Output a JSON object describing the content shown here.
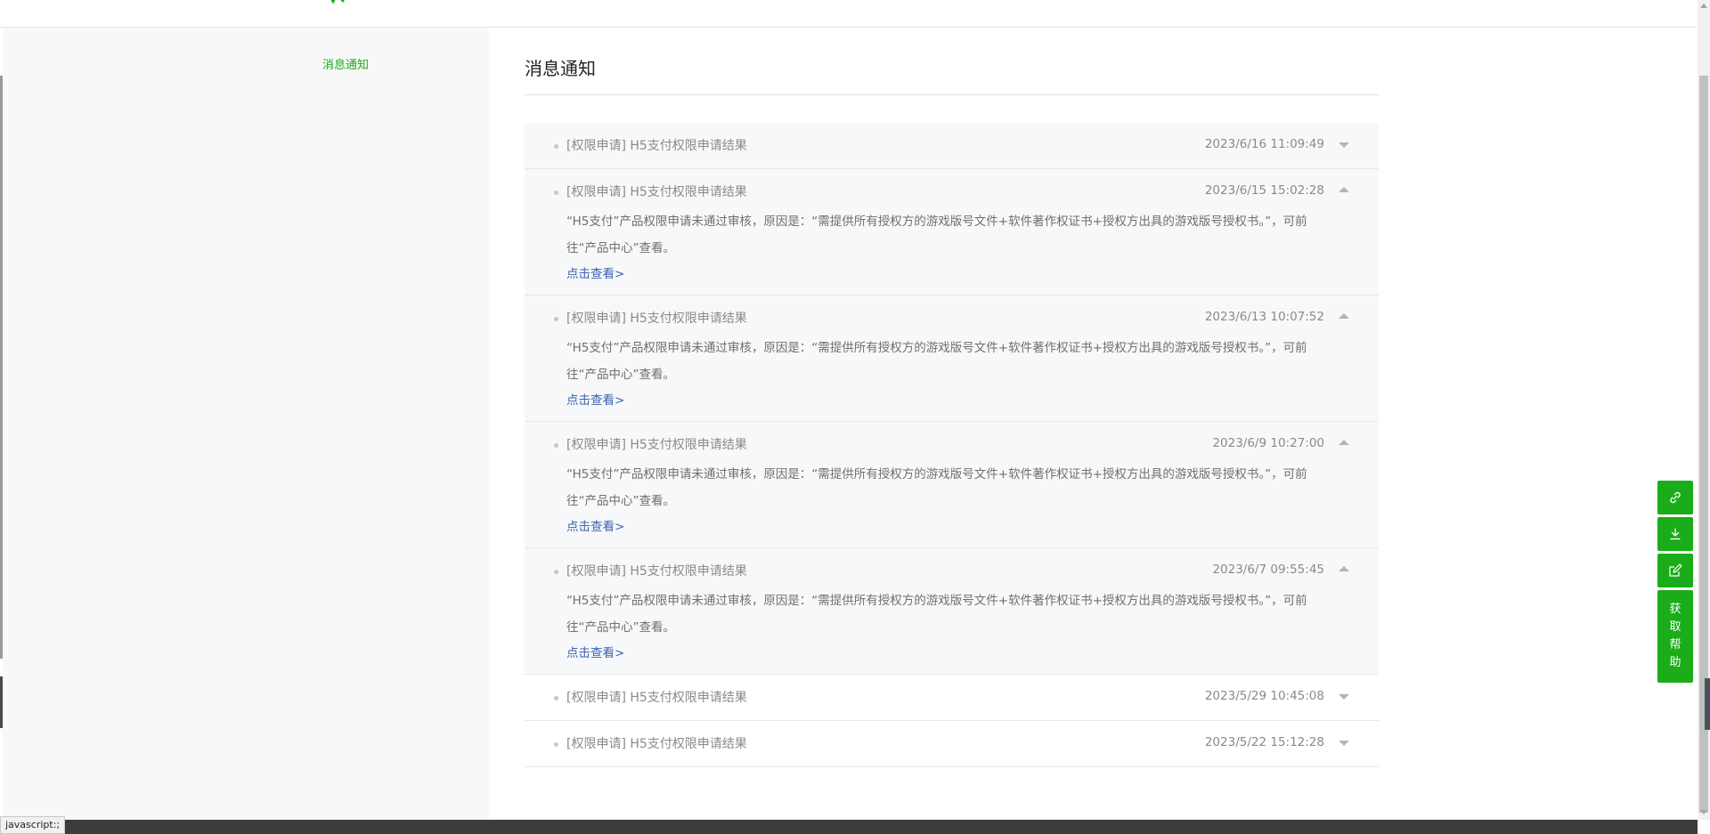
{
  "sidebar": {
    "items": [
      {
        "label": "消息通知"
      }
    ]
  },
  "main": {
    "title": "消息通知",
    "notifications": [
      {
        "title": "[权限申请] H5支付权限申请结果",
        "time": "2023/6/16 11:09:49",
        "expanded": false
      },
      {
        "title": "[权限申请] H5支付权限申请结果",
        "time": "2023/6/15 15:02:28",
        "expanded": true,
        "body": "“H5支付”产品权限申请未通过审核，原因是：“需提供所有授权方的游戏版号文件+软件著作权证书+授权方出具的游戏版号授权书。”，可前往“产品中心”查看。",
        "link": "点击查看>"
      },
      {
        "title": "[权限申请] H5支付权限申请结果",
        "time": "2023/6/13 10:07:52",
        "expanded": true,
        "body": "“H5支付”产品权限申请未通过审核，原因是：“需提供所有授权方的游戏版号文件+软件著作权证书+授权方出具的游戏版号授权书。”，可前往“产品中心”查看。",
        "link": "点击查看>"
      },
      {
        "title": "[权限申请] H5支付权限申请结果",
        "time": "2023/6/9 10:27:00",
        "expanded": true,
        "body": "“H5支付”产品权限申请未通过审核，原因是：“需提供所有授权方的游戏版号文件+软件著作权证书+授权方出具的游戏版号授权书。”，可前往“产品中心”查看。",
        "link": "点击查看>"
      },
      {
        "title": "[权限申请] H5支付权限申请结果",
        "time": "2023/6/7 09:55:45",
        "expanded": true,
        "body": "“H5支付”产品权限申请未通过审核，原因是：“需提供所有授权方的游戏版号文件+软件著作权证书+授权方出具的游戏版号授权书。”，可前往“产品中心”查看。",
        "link": "点击查看>"
      },
      {
        "title": "[权限申请] H5支付权限申请结果",
        "time": "2023/5/29 10:45:08",
        "expanded": false
      },
      {
        "title": "[权限申请] H5支付权限申请结果",
        "time": "2023/5/22 15:12:28",
        "expanded": false
      }
    ]
  },
  "float_tools": {
    "icons": [
      "link-icon",
      "download-icon",
      "edit-icon"
    ],
    "help_chars": [
      "获",
      "取",
      "帮",
      "助"
    ]
  },
  "status_bar": {
    "text": "javascript:;"
  },
  "colors": {
    "accent": "#1aad19",
    "link": "#3a63b0"
  }
}
